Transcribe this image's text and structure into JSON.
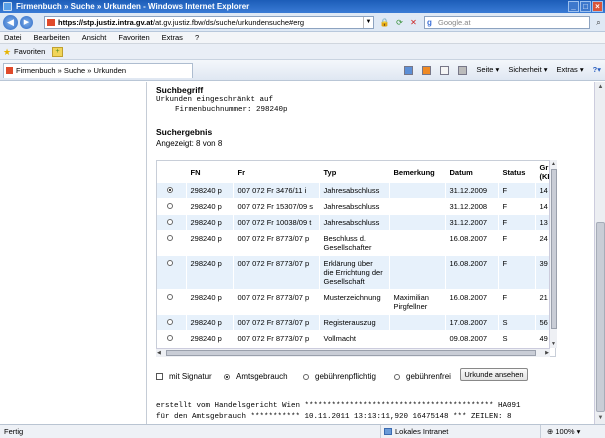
{
  "window": {
    "title": "Firmenbuch » Suche » Urkunden - Windows Internet Explorer"
  },
  "address": {
    "url_host": "https://stp.justiz.intra.gv.at",
    "url_path": "/at.gv.justiz.fbw/ds/suche/urkundensuche#erg",
    "search_placeholder": "Google.at"
  },
  "menu": [
    "Datei",
    "Bearbeiten",
    "Ansicht",
    "Favoriten",
    "Extras",
    "?"
  ],
  "favorites": {
    "label": "Favoriten"
  },
  "tab": {
    "title": "Firmenbuch » Suche » Urkunden"
  },
  "commandbar": {
    "seite": "Seite ▾",
    "sicherheit": "Sicherheit ▾",
    "extras": "Extras ▾",
    "help": "?▾"
  },
  "page": {
    "suchbegriff_heading": "Suchbegriff",
    "suchbegriff_line1": "Urkunden eingeschränkt auf",
    "suchbegriff_line2": "Firmenbuchnummer: 298240p",
    "ergebnis_heading": "Suchergebnis",
    "angezeigt": "Angezeigt: 8 von 8"
  },
  "table": {
    "headers": [
      "FN",
      "Fr",
      "Typ",
      "Bemerkung",
      "Datum",
      "Status",
      "Gr (KE"
    ],
    "rows": [
      {
        "selected": true,
        "fn": "298240 p",
        "fr": "007 072 Fr 3476/11 i",
        "typ": "Jahresabschluss",
        "bem": "",
        "datum": "31.12.2009",
        "status": "F",
        "gr": "14"
      },
      {
        "selected": false,
        "fn": "298240 p",
        "fr": "007 072 Fr 15307/09 s",
        "typ": "Jahresabschluss",
        "bem": "",
        "datum": "31.12.2008",
        "status": "F",
        "gr": "14"
      },
      {
        "selected": false,
        "fn": "298240 p",
        "fr": "007 072 Fr 10038/09 t",
        "typ": "Jahresabschluss",
        "bem": "",
        "datum": "31.12.2007",
        "status": "F",
        "gr": "13"
      },
      {
        "selected": false,
        "fn": "298240 p",
        "fr": "007 072 Fr 8773/07 p",
        "typ": "Beschluss d. Gesellschafter",
        "bem": "",
        "datum": "16.08.2007",
        "status": "F",
        "gr": "24"
      },
      {
        "selected": false,
        "fn": "298240 p",
        "fr": "007 072 Fr 8773/07 p",
        "typ": "Erklärung über die Errichtung der Gesellschaft",
        "bem": "",
        "datum": "16.08.2007",
        "status": "F",
        "gr": "39"
      },
      {
        "selected": false,
        "fn": "298240 p",
        "fr": "007 072 Fr 8773/07 p",
        "typ": "Musterzeichnung",
        "bem": "Maximilian Pirgfellner",
        "datum": "16.08.2007",
        "status": "F",
        "gr": "21"
      },
      {
        "selected": false,
        "fn": "298240 p",
        "fr": "007 072 Fr 8773/07 p",
        "typ": "Registerauszug",
        "bem": "",
        "datum": "17.08.2007",
        "status": "S",
        "gr": "56"
      },
      {
        "selected": false,
        "fn": "298240 p",
        "fr": "007 072 Fr 8773/07 p",
        "typ": "Vollmacht",
        "bem": "",
        "datum": "09.08.2007",
        "status": "S",
        "gr": "49"
      }
    ]
  },
  "options": {
    "mit_signatur": "mit Signatur",
    "amtsgebrauch": "Amtsgebrauch",
    "gebuehrenpflichtig": "gebührenpflichtig",
    "gebuehrenfrei": "gebührenfrei",
    "button": "Urkunde ansehen"
  },
  "footer": {
    "line1": "erstellt vom Handelsgericht Wien ****************************************** HA091",
    "line2": "für den Amtsgebrauch *********** 10.11.2011 13:13:11,920 16475148 *** ZEILEN: 8"
  },
  "status": {
    "left": "Fertig",
    "zone": "Lokales Intranet",
    "zoom": "100%"
  }
}
